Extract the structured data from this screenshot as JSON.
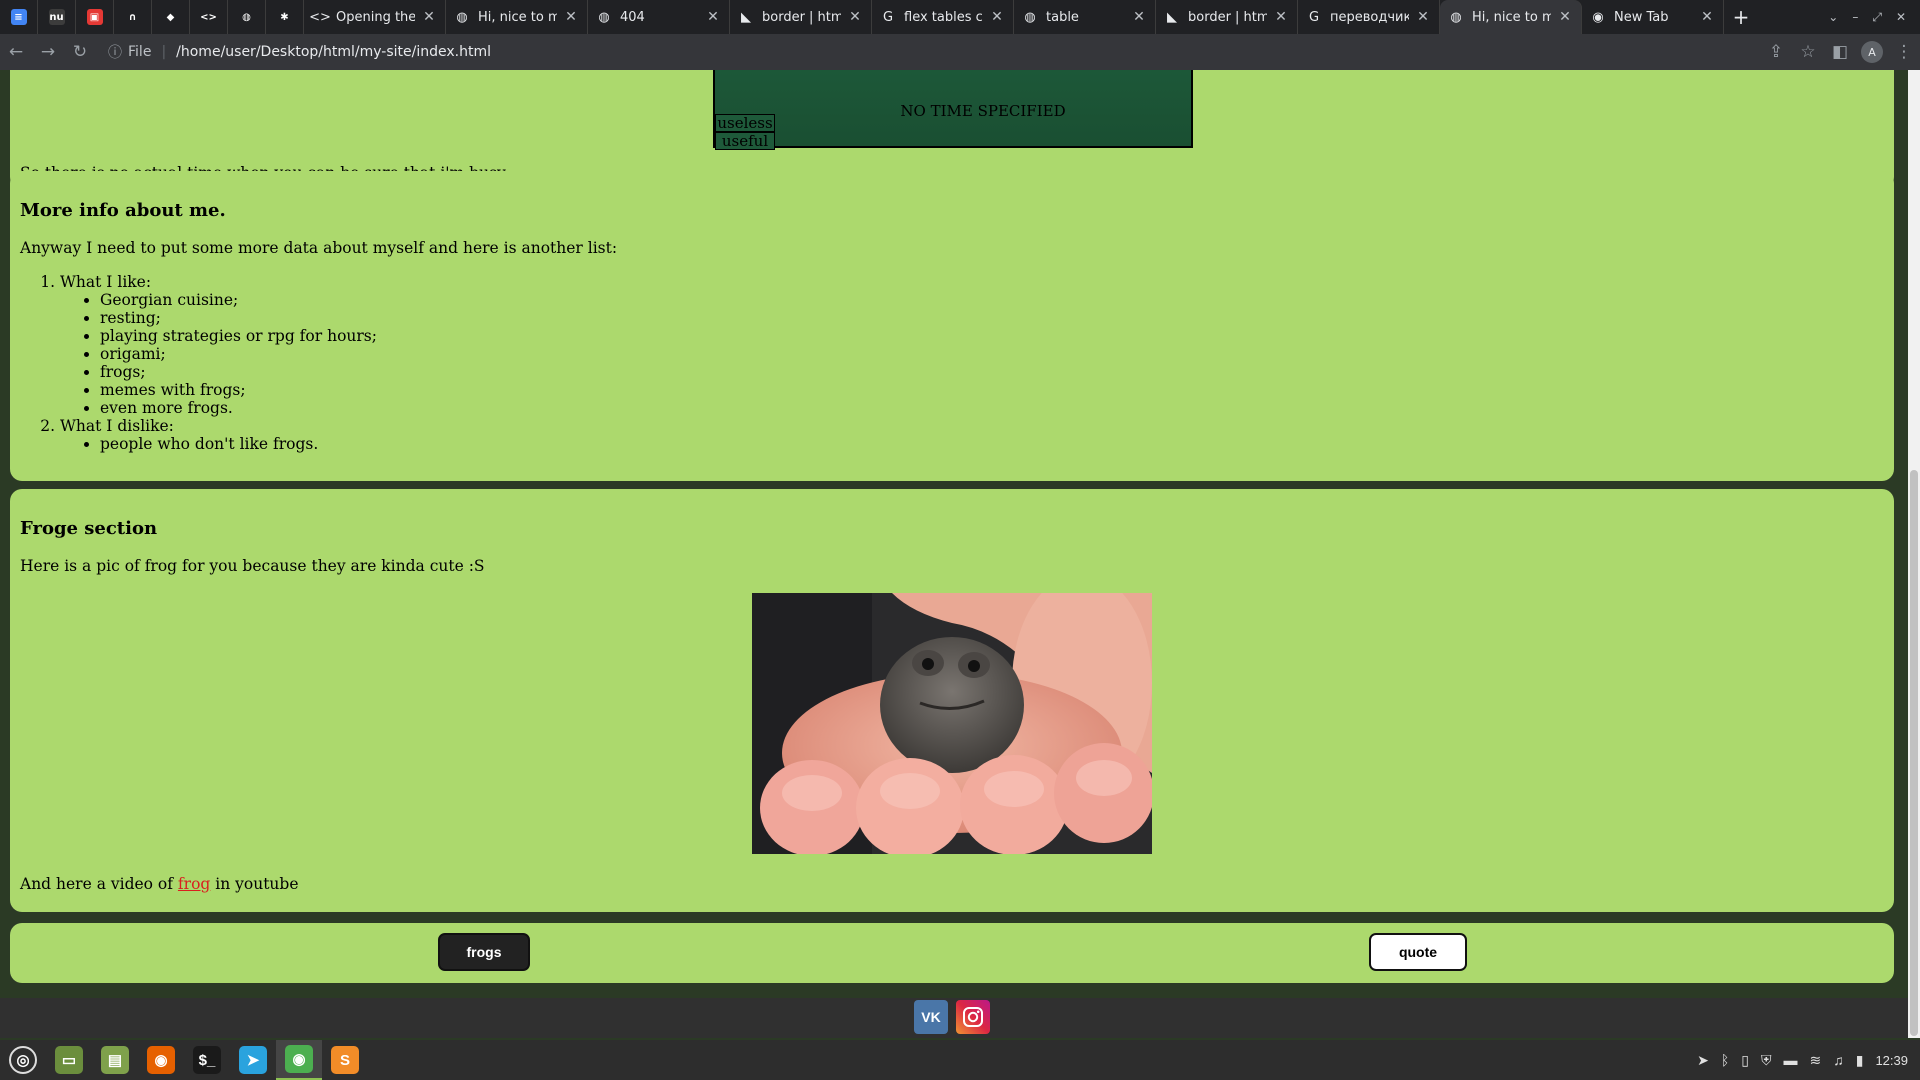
{
  "browser": {
    "pinned_tabs": [
      {
        "icon": "docs-icon",
        "color": "#4285f4",
        "glyph": "≡"
      },
      {
        "icon": "nu-icon",
        "color": "#3c3c3c",
        "glyph": "nu"
      },
      {
        "icon": "red-app-icon",
        "color": "#e53935",
        "glyph": "▣"
      },
      {
        "icon": "green-spiral-icon",
        "color": "#202124",
        "glyph": "∩"
      },
      {
        "icon": "gitlab-icon",
        "color": "#202124",
        "glyph": "◆"
      },
      {
        "icon": "code-icon",
        "color": "#202124",
        "glyph": "<>"
      },
      {
        "icon": "globe-icon",
        "color": "#202124",
        "glyph": "◍"
      },
      {
        "icon": "asterisk-icon",
        "color": "#202124",
        "glyph": "✱"
      }
    ],
    "tabs": [
      {
        "icon": "code-icon",
        "title": "Opening the",
        "active": false
      },
      {
        "icon": "globe-icon",
        "title": "Hi, nice to me",
        "active": false
      },
      {
        "icon": "globe-icon",
        "title": "404",
        "active": false
      },
      {
        "icon": "mdn-icon",
        "title": "border | htm",
        "active": false
      },
      {
        "icon": "google-icon",
        "title": "flex tables c",
        "active": false
      },
      {
        "icon": "globe-icon",
        "title": "table",
        "active": false
      },
      {
        "icon": "mdn-icon",
        "title": "border | htm",
        "active": false
      },
      {
        "icon": "google-icon",
        "title": "переводчик",
        "active": false
      },
      {
        "icon": "globe-icon",
        "title": "Hi, nice to me",
        "active": true
      },
      {
        "icon": "chrome-icon",
        "title": "New Tab",
        "active": false
      }
    ],
    "new_tab_glyph": "+",
    "address": {
      "scheme_label": "File",
      "url": "/home/user/Desktop/html/my-site/index.html"
    }
  },
  "page": {
    "schedule_table": {
      "cell_top": "useless",
      "cell_bottom": "useful",
      "center_text": "NO TIME SPECIFIED"
    },
    "busy_text": "So there is no actual time when you can be sure that i'm busy.",
    "more_info": {
      "heading": "More info about me.",
      "intro": "Anyway I need to put some more data about myself and here is another list:",
      "likes_label": "What I like:",
      "likes": [
        "Georgian cuisine;",
        "resting;",
        "playing strategies or rpg for hours;",
        "origami;",
        "frogs;",
        "memes with frogs;",
        "even more frogs."
      ],
      "dislikes_label": "What I dislike:",
      "dislikes": [
        "people who don't like frogs."
      ]
    },
    "froge": {
      "heading": "Froge section",
      "intro": "Here is a pic of frog for you because they are kinda cute :S",
      "video_before": "And here a video of ",
      "video_link": "frog",
      "video_after": " in youtube"
    },
    "buttons": {
      "frogs": "frogs",
      "quote": "quote"
    },
    "social": [
      {
        "icon": "vk-icon",
        "label": "VK"
      },
      {
        "icon": "instagram-icon",
        "label": ""
      }
    ],
    "colors": {
      "card_bg": "#acd96d",
      "page_bg": "#2b3a25",
      "link": "#d9201f"
    }
  },
  "taskbar": {
    "apps": [
      {
        "icon": "mint-menu-icon",
        "color": "#2d2d2d",
        "glyph": "◎"
      },
      {
        "icon": "desktop-icon",
        "color": "#6b8e3d",
        "glyph": "▭"
      },
      {
        "icon": "files-icon",
        "color": "#7fa14b",
        "glyph": "▤"
      },
      {
        "icon": "firefox-icon",
        "color": "#e66000",
        "glyph": "◉"
      },
      {
        "icon": "terminal-icon",
        "color": "#1a1a1a",
        "glyph": "$_"
      },
      {
        "icon": "telegram-icon",
        "color": "#2aa3de",
        "glyph": "➤"
      },
      {
        "icon": "chrome-icon",
        "color": "#4caf50",
        "glyph": "◉"
      },
      {
        "icon": "sublime-icon",
        "color": "#f28c28",
        "glyph": "S"
      }
    ],
    "clock": "12:39"
  }
}
